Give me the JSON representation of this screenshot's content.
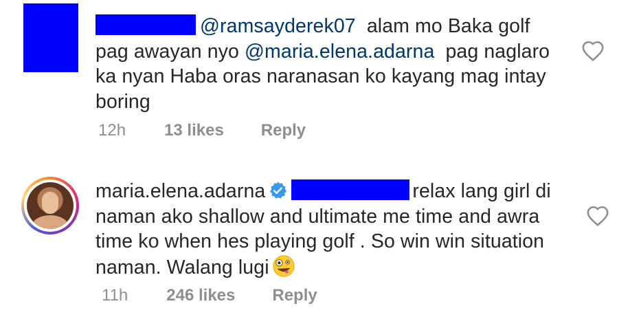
{
  "comments": [
    {
      "handle_redacted": true,
      "avatar_redacted": true,
      "text_parts": {
        "mention_1": "@ramsayderek07",
        "text_1": "alam mo Baka golf pag awayan nyo",
        "mention_2": "@maria.elena.adarna",
        "text_2": "pag naglaro ka nyan Haba oras naranasan ko kayang mag intay boring"
      },
      "time": "12h",
      "likes": "13 likes",
      "reply_label": "Reply",
      "like_icon": "heart-outline-icon"
    },
    {
      "username": "maria.elena.adarna",
      "verified": true,
      "verified_icon": "verified-badge-icon",
      "mention_redacted": true,
      "text_parts": {
        "text_1": "relax lang girl di naman ako shallow and ultimate me time and awra time ko when hes playing golf . So win win situation naman. Walang lugi",
        "emoji": "zany-face-emoji"
      },
      "time": "11h",
      "likes": "246 likes",
      "reply_label": "Reply",
      "like_icon": "heart-outline-icon"
    }
  ],
  "colors": {
    "redaction": "#0000ff",
    "text": "#262626",
    "mention": "#00376b",
    "meta": "#8e8e8e",
    "verified": "#3897f0"
  }
}
